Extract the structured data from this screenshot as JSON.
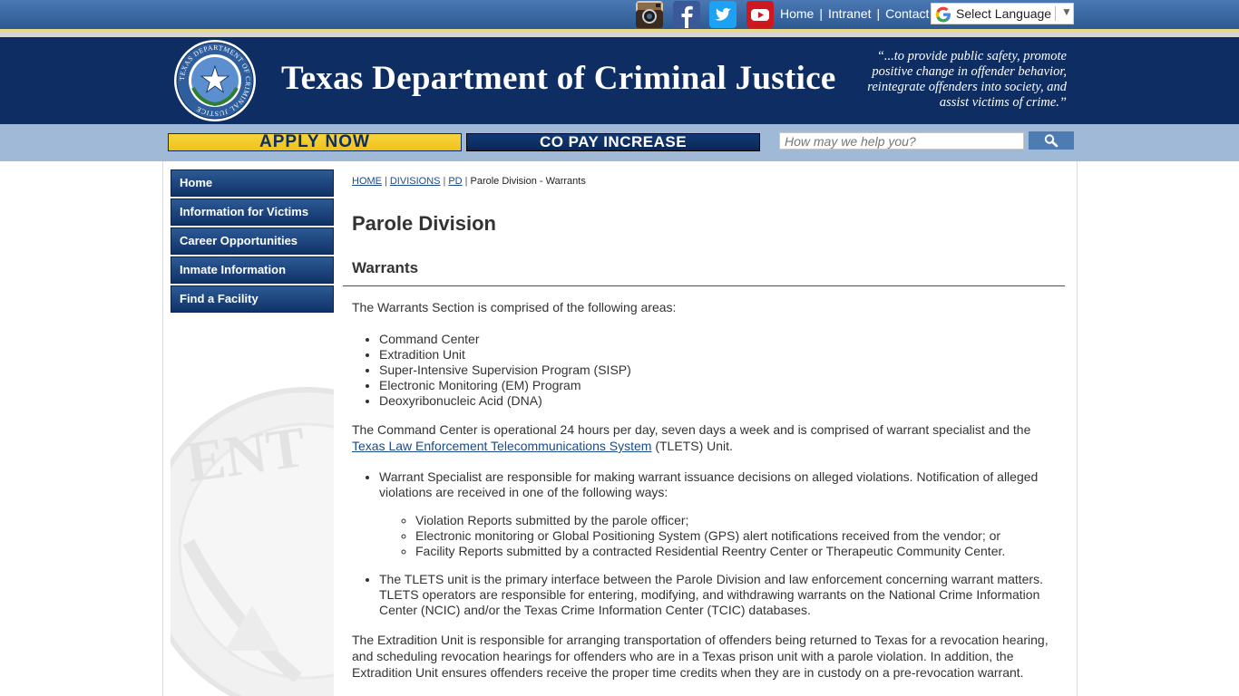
{
  "topbar": {
    "social": [
      {
        "name": "instagram-icon",
        "color": "#3b2a20"
      },
      {
        "name": "facebook-icon",
        "color": "#3b5998"
      },
      {
        "name": "twitter-icon",
        "color": "#1da1f2"
      },
      {
        "name": "youtube-icon",
        "color": "#cc181e"
      }
    ],
    "links": [
      {
        "label": "Home"
      },
      {
        "label": "Intranet"
      },
      {
        "label": "Contact"
      }
    ],
    "separator": "|",
    "language": {
      "label": "Select Language",
      "caret": "▼"
    }
  },
  "header": {
    "title": "Texas Department of Criminal Justice",
    "motto": "“...to provide public safety, promote positive change in offender behavior, reintegrate offenders into society, and assist victims of crime.”",
    "seal_text": "TEXAS DEPARTMENT OF CRIMINAL JUSTICE"
  },
  "promo": {
    "apply_label": "APPLY NOW",
    "copay_label": "CO PAY INCREASE",
    "apply_color": "#f5cc2a",
    "copay_color": "#0d2d63"
  },
  "search": {
    "placeholder": "How may we help you?"
  },
  "sidebar": {
    "items": [
      {
        "label": "Home"
      },
      {
        "label": "Information for Victims"
      },
      {
        "label": "Career Opportunities"
      },
      {
        "label": "Inmate Information"
      },
      {
        "label": "Find a Facility"
      }
    ]
  },
  "breadcrumb": {
    "items": [
      {
        "label": "HOME",
        "link": true
      },
      {
        "label": "DIVISIONS",
        "link": true
      },
      {
        "label": "PD",
        "link": true
      },
      {
        "label": "Parole Division - Warrants",
        "link": false
      }
    ],
    "separator": "|"
  },
  "main": {
    "title": "Parole Division",
    "section": "Warrants",
    "intro": "The Warrants Section is comprised of the following areas:",
    "areas": [
      "Command Center",
      "Extradition Unit",
      "Super-Intensive Supervision Program (SISP)",
      "Electronic Monitoring (EM) Program",
      "Deoxyribonucleic Acid (DNA)"
    ],
    "command_center": {
      "before": "The Command Center is operational 24 hours per day, seven days a week and is comprised of warrant specialist and the ",
      "link": "Texas Law Enforcement Telecommunications System",
      "after": " (TLETS) Unit."
    },
    "specialists": "Warrant Specialist are responsible for making warrant issuance decisions on alleged violations. Notification of alleged violations are received in one of the following ways:",
    "ways": [
      "Violation Reports submitted by the parole officer;",
      "Electronic monitoring or Global Positioning System (GPS) alert notifications received from the vendor; or",
      "Facility Reports submitted by a contracted Residential Reentry Center or Therapeutic Community Center."
    ],
    "tlets": "The TLETS unit is the primary interface between the Parole Division and law enforcement concerning warrant matters. TLETS operators are responsible for entering, modifying, and withdrawing warrants on the National Crime Information Center (NCIC) and/or the Texas Crime Information Center (TCIC) databases.",
    "extradition": "The Extradition Unit is responsible for arranging transportation of offenders being returned to Texas for a revocation hearing, and scheduling revocation hearings for offenders who are in a Texas prison unit with a parole violation. In addition, the Extradition Unit ensures offenders receive the proper time credits when they are in custody on a pre-revocation warrant."
  }
}
